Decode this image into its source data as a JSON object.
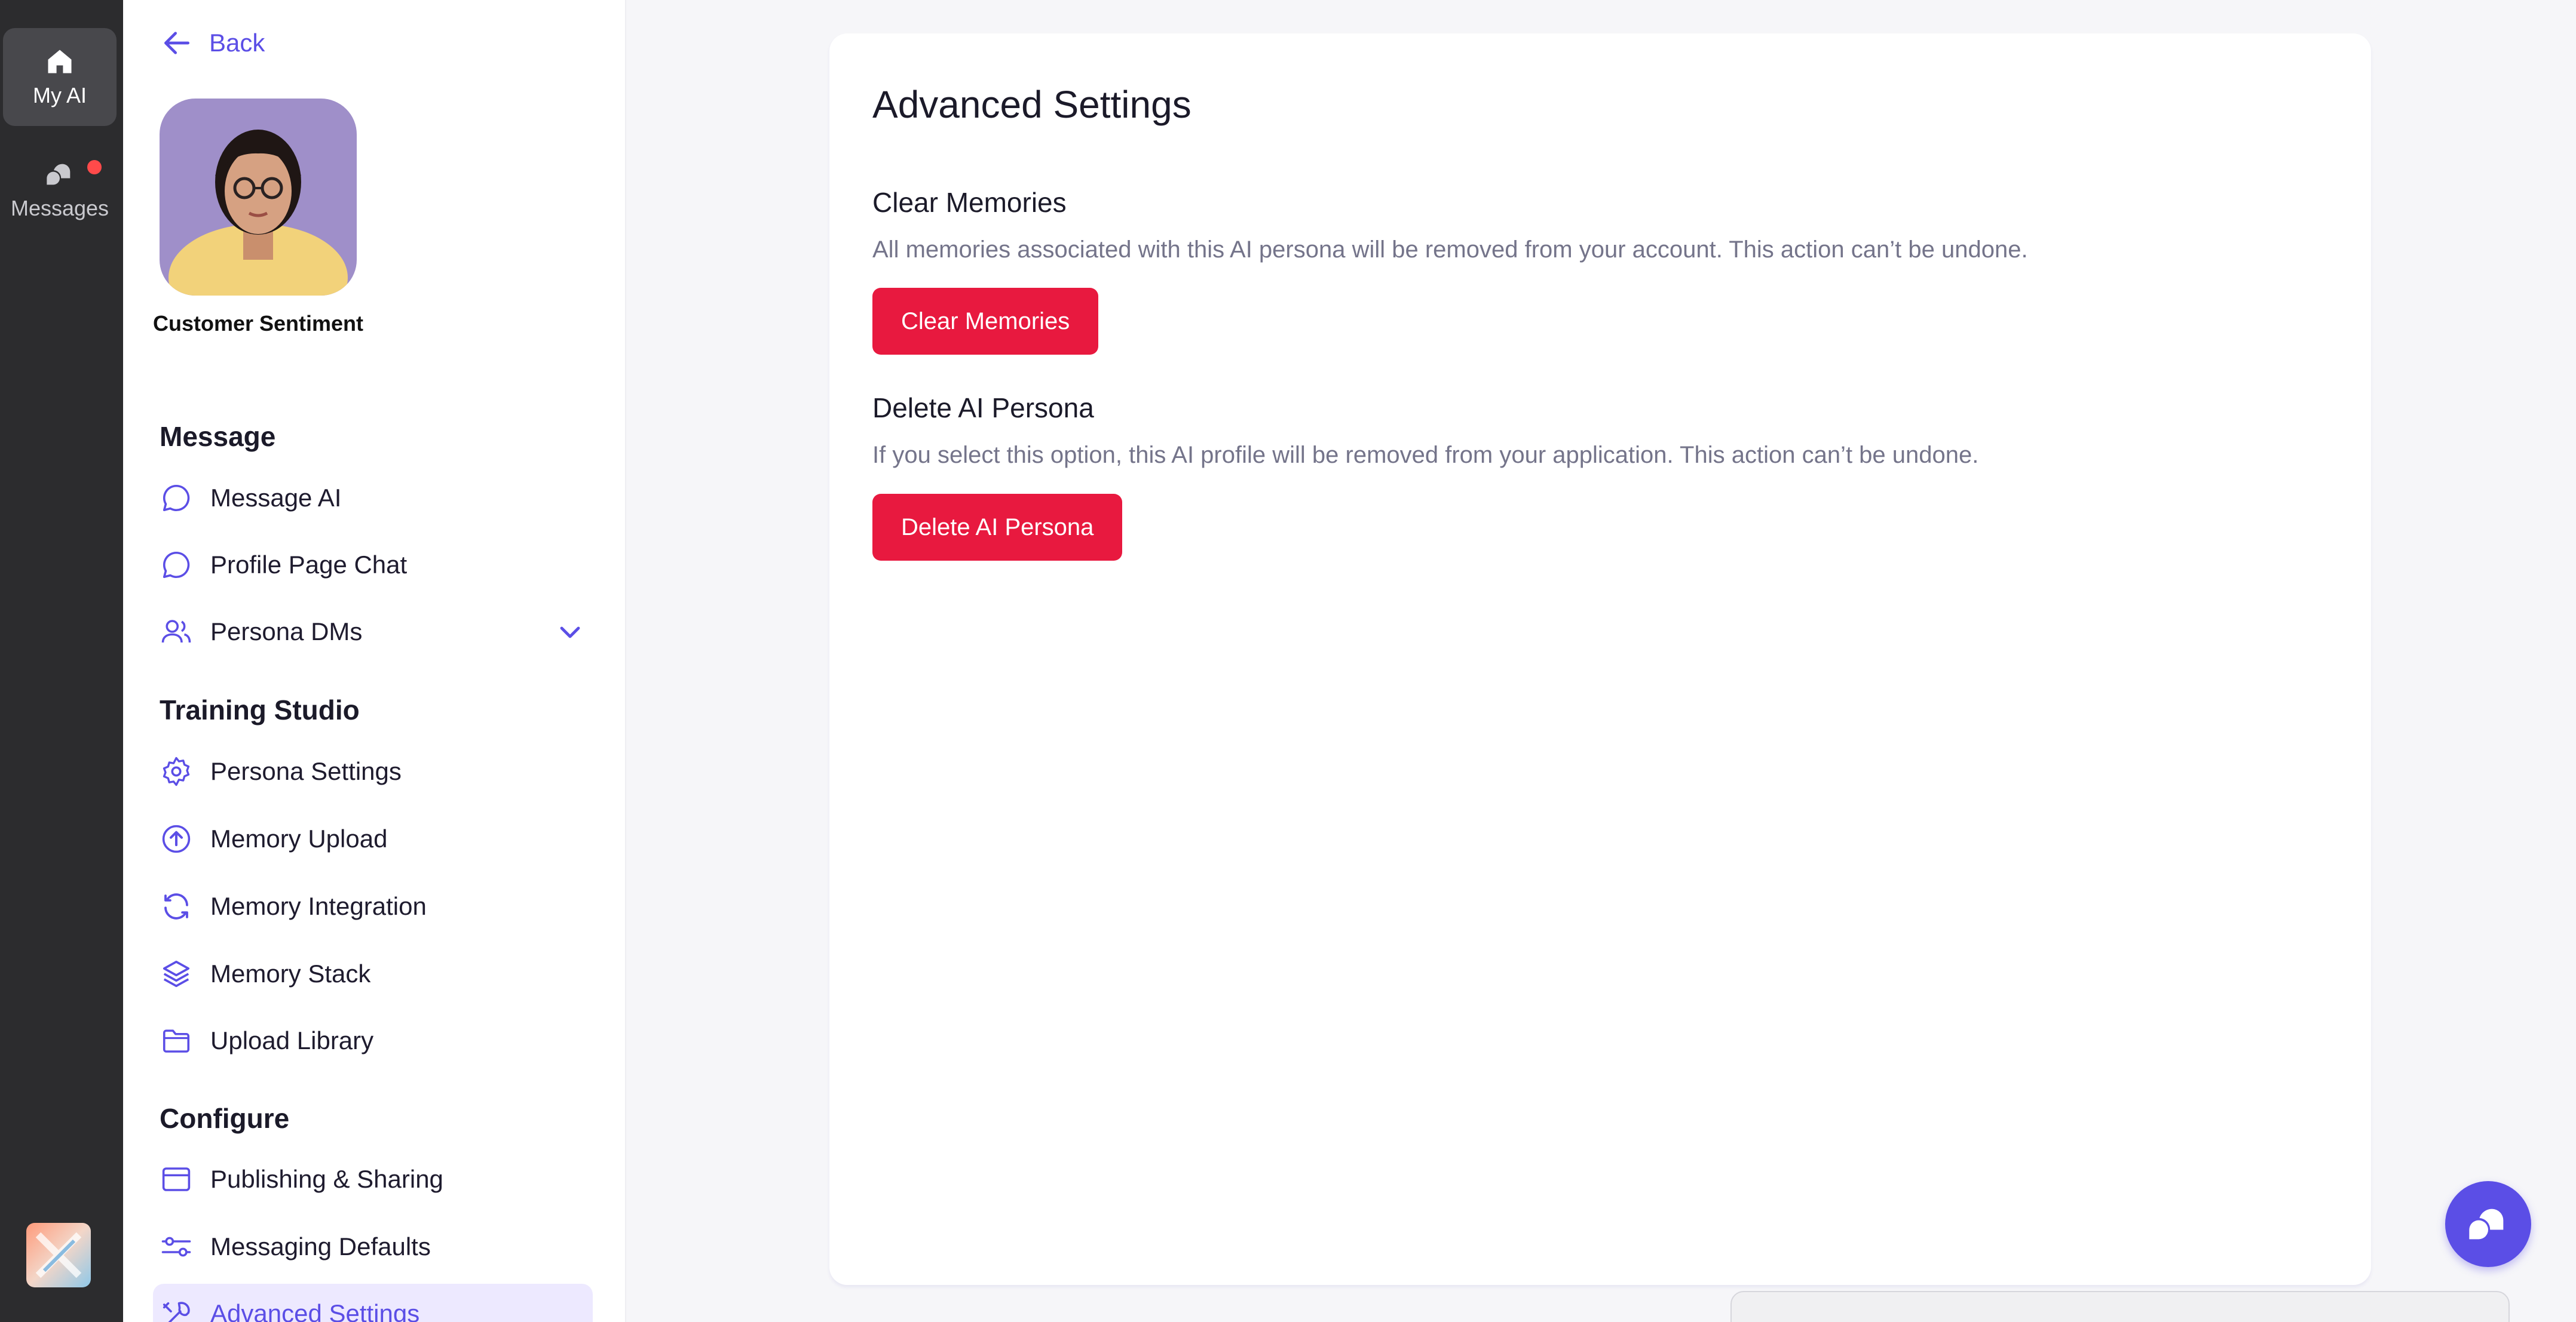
{
  "rail": {
    "my_ai_label": "My AI",
    "messages_label": "Messages"
  },
  "sidebar": {
    "back_label": "Back",
    "persona_name": "Customer Sentiment",
    "sections": [
      {
        "title": "Message",
        "items": [
          {
            "label": "Message AI",
            "icon": "chat-bubble-icon"
          },
          {
            "label": "Profile Page Chat",
            "icon": "chat-bubble-icon"
          },
          {
            "label": "Persona DMs",
            "icon": "users-icon"
          }
        ]
      },
      {
        "title": "Training Studio",
        "items": [
          {
            "label": "Persona Settings",
            "icon": "gear-icon"
          },
          {
            "label": "Memory Upload",
            "icon": "upload-circle-icon"
          },
          {
            "label": "Memory Integration",
            "icon": "sync-icon"
          },
          {
            "label": "Memory Stack",
            "icon": "layers-icon"
          },
          {
            "label": "Upload Library",
            "icon": "folder-icon"
          }
        ]
      },
      {
        "title": "Configure",
        "items": [
          {
            "label": "Publishing & Sharing",
            "icon": "browser-window-icon"
          },
          {
            "label": "Messaging Defaults",
            "icon": "sliders-icon"
          },
          {
            "label": "Advanced Settings",
            "icon": "tools-icon",
            "selected": true
          }
        ]
      }
    ]
  },
  "main": {
    "title": "Advanced Settings",
    "clear": {
      "title": "Clear Memories",
      "description": "All memories associated with this AI persona will be removed from your account. This action can’t be undone.",
      "button_label": "Clear Memories"
    },
    "delete": {
      "title": "Delete AI Persona",
      "description": "If you select this option, this AI profile will be removed from your application. This action can’t be undone.",
      "button_label": "Delete AI Persona"
    }
  },
  "colors": {
    "accent": "#5b4ee6",
    "danger": "#e8193f",
    "rail_bg": "#2c2c2e",
    "selected_bg": "#ede9ff"
  }
}
